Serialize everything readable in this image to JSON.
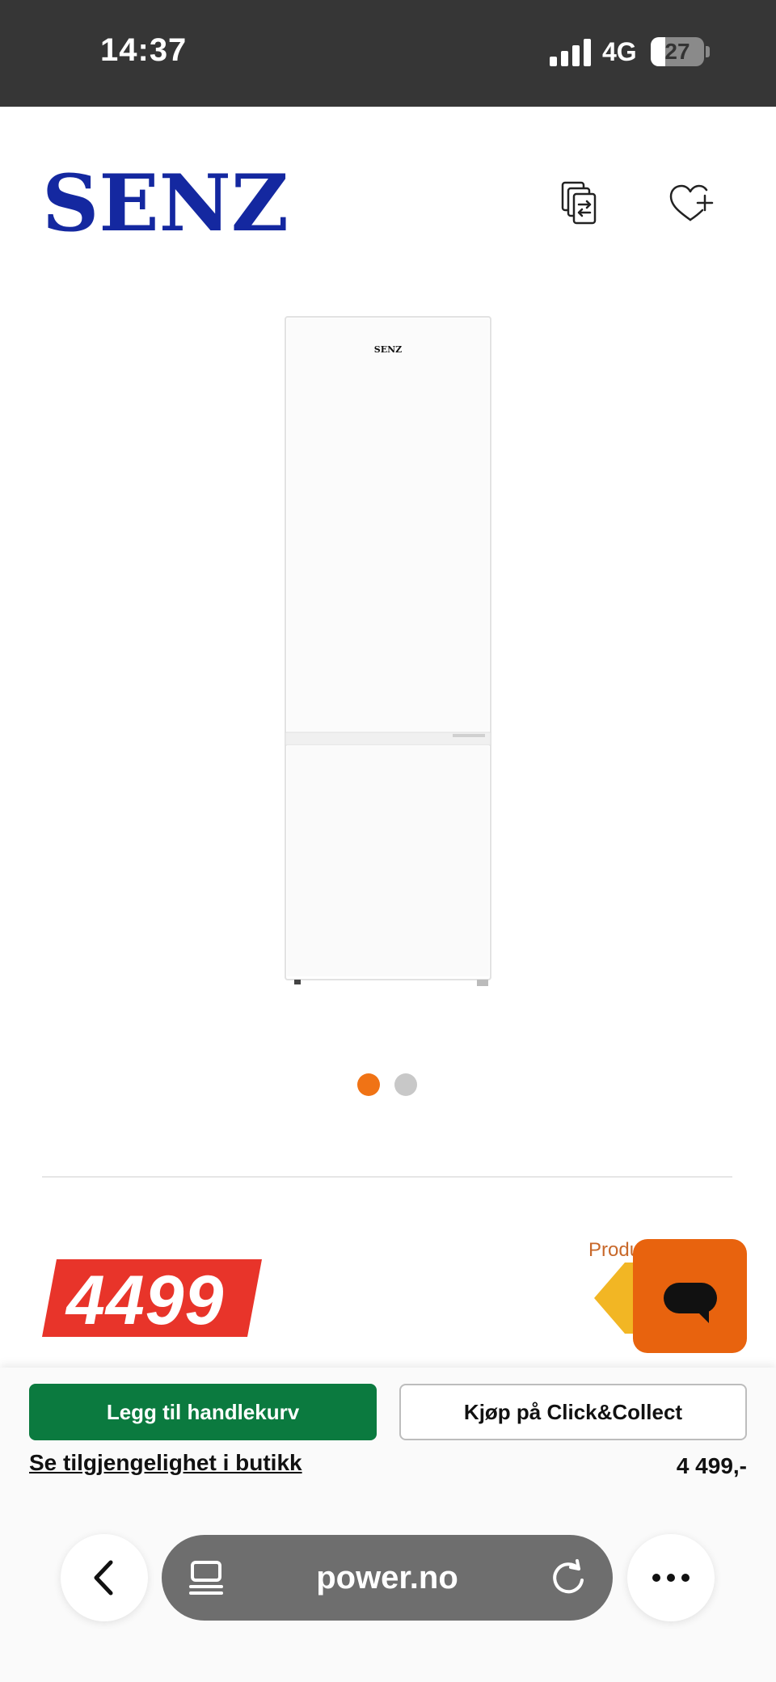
{
  "status_bar": {
    "time": "14:37",
    "network": "4G",
    "battery_level": "27",
    "battery_fraction": 0.27,
    "signal_bars": 4
  },
  "header": {
    "brand": "SENZ",
    "brand_color": "#1428a0",
    "compare_icon": "compare-icon",
    "wishlist_icon": "heart-plus-icon"
  },
  "gallery": {
    "image_label": "SENZ",
    "active_dot_color": "#f07315",
    "inactive_dot_color": "#c8c8c8",
    "dot_count": 2,
    "active_index": 0
  },
  "pricing": {
    "price": "4499",
    "price_tag_color": "#e8342a",
    "product_label": "Produ"
  },
  "chat": {
    "icon": "chat-bubble-icon",
    "color": "#e8630e"
  },
  "actions": {
    "add_to_cart": "Legg til handlekurv",
    "click_collect": "Kjøp på Click&Collect",
    "availability": "Se tilgjengelighet i butikk",
    "price": "4 499,-"
  },
  "browser": {
    "url": "power.no",
    "back_icon": "chevron-left-icon",
    "page_icon": "page-menu-icon",
    "reload_icon": "reload-icon",
    "more_icon": "more-icon"
  }
}
